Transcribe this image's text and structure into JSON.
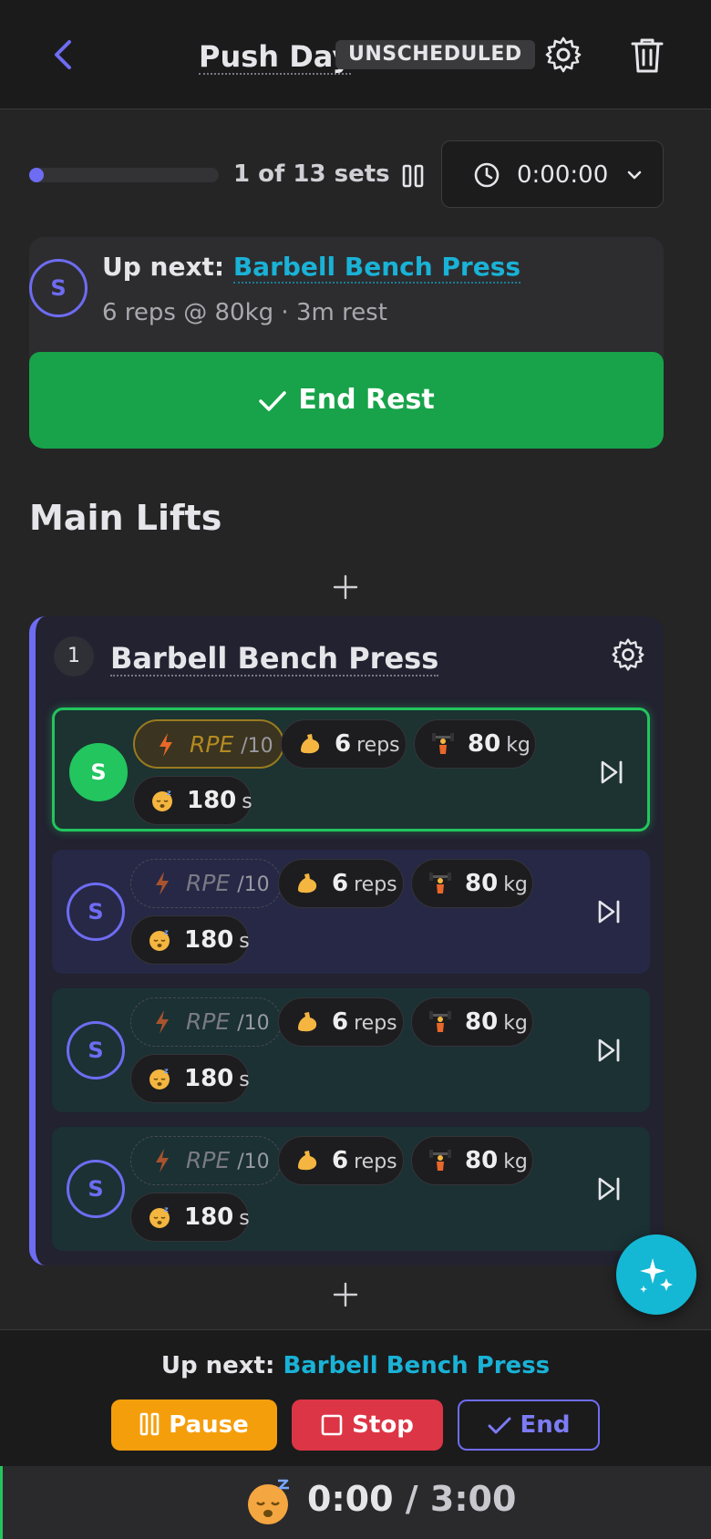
{
  "header": {
    "title": "Push Day",
    "badge": "UNSCHEDULED"
  },
  "progress": {
    "label": "1 of 13 sets",
    "fraction": 0.04,
    "timer": "0:00:00"
  },
  "up_next_card": {
    "circle": "S",
    "prefix": "Up next: ",
    "exercise": "Barbell Bench Press",
    "details": "6 reps @ 80kg · 3m rest",
    "end_rest_label": "End Rest"
  },
  "section": {
    "title": "Main Lifts"
  },
  "exercise": {
    "number": "1",
    "name": "Barbell Bench Press",
    "sets": [
      {
        "circle": "S",
        "rpe": "RPE",
        "rpe_den": "/10",
        "reps": "6",
        "reps_unit": "reps",
        "weight": "80",
        "weight_unit": "kg",
        "rest": "180",
        "rest_unit": "s"
      },
      {
        "circle": "S",
        "rpe": "RPE",
        "rpe_den": "/10",
        "reps": "6",
        "reps_unit": "reps",
        "weight": "80",
        "weight_unit": "kg",
        "rest": "180",
        "rest_unit": "s"
      },
      {
        "circle": "S",
        "rpe": "RPE",
        "rpe_den": "/10",
        "reps": "6",
        "reps_unit": "reps",
        "weight": "80",
        "weight_unit": "kg",
        "rest": "180",
        "rest_unit": "s"
      },
      {
        "circle": "S",
        "rpe": "RPE",
        "rpe_den": "/10",
        "reps": "6",
        "reps_unit": "reps",
        "weight": "80",
        "weight_unit": "kg",
        "rest": "180",
        "rest_unit": "s"
      }
    ]
  },
  "bottom": {
    "prefix": "Up next: ",
    "exercise": "Barbell Bench Press",
    "pause_label": "Pause",
    "stop_label": "Stop",
    "end_label": "End"
  },
  "rest_timer": {
    "elapsed": "0:00",
    "separator": " / ",
    "total": "3:00"
  },
  "colors": {
    "accent": "#6e6cf2",
    "success": "#22c55e",
    "link": "#1ab2d6",
    "warning": "#f59e0b",
    "danger": "#dc3545"
  },
  "icons": [
    "chevron-left-icon",
    "gear-icon",
    "trash-icon",
    "pause-icon",
    "clock-icon",
    "chevron-down-icon",
    "check-icon",
    "plus-icon",
    "lightning-icon",
    "flexed-biceps-icon",
    "weightlifter-icon",
    "sleeping-face-icon",
    "skip-next-icon",
    "sparkles-icon",
    "stop-square-icon"
  ]
}
